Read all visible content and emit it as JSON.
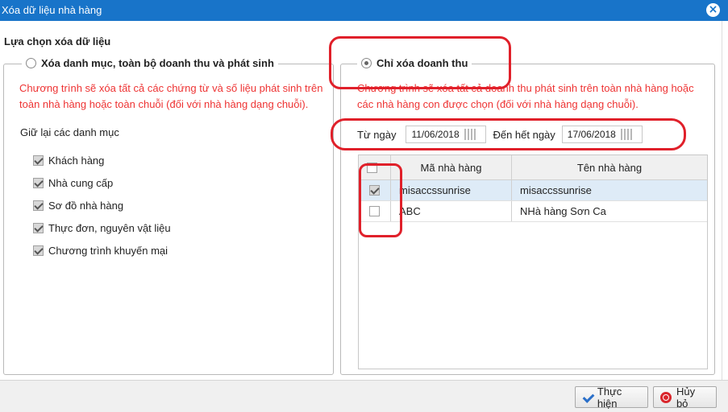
{
  "window": {
    "title": "Xóa dữ liệu nhà hàng"
  },
  "section_title": "Lựa chọn xóa dữ liệu",
  "left_panel": {
    "option_label": "Xóa danh mục, toàn bộ doanh thu và phát sinh",
    "selected": false,
    "description": "Chương trình sẽ xóa tất cả các chứng từ và số liệu phát sinh trên toàn nhà hàng hoặc toàn chuỗi (đối với nhà hàng dạng chuỗi).",
    "keep_label": "Giữ lại các danh mục",
    "keep_items": [
      {
        "label": "Khách hàng",
        "checked": true
      },
      {
        "label": "Nhà cung cấp",
        "checked": true
      },
      {
        "label": "Sơ đồ nhà hàng",
        "checked": true
      },
      {
        "label": "Thực đơn, nguyên vật liệu",
        "checked": true
      },
      {
        "label": "Chương trình khuyến mại",
        "checked": true
      }
    ]
  },
  "right_panel": {
    "option_label": "Chỉ xóa doanh thu",
    "selected": true,
    "description": "Chương trình sẽ xóa tất cả doanh thu phát sinh trên toàn nhà hàng hoặc các nhà hàng con được chọn (đối với nhà hàng dạng chuỗi).",
    "from_label": "Từ ngày",
    "from_value": "11/06/2018",
    "to_label": "Đến hết ngày",
    "to_value": "17/06/2018",
    "table": {
      "columns": [
        "Mã nhà hàng",
        "Tên nhà hàng"
      ],
      "rows": [
        {
          "code": "misaccssunrise",
          "name": "misaccssunrise",
          "checked": true
        },
        {
          "code": "ABC",
          "name": "NHà hàng Sơn Ca",
          "checked": false
        }
      ]
    }
  },
  "buttons": {
    "ok": "Thực hiện",
    "cancel": "Hủy bỏ"
  },
  "icons": [
    "close-icon",
    "calendar-icon",
    "check-icon",
    "cancel-icon"
  ],
  "colors": {
    "titlebar": "#1874c9",
    "warning_text": "#e33333",
    "annotation": "#e0202a"
  }
}
